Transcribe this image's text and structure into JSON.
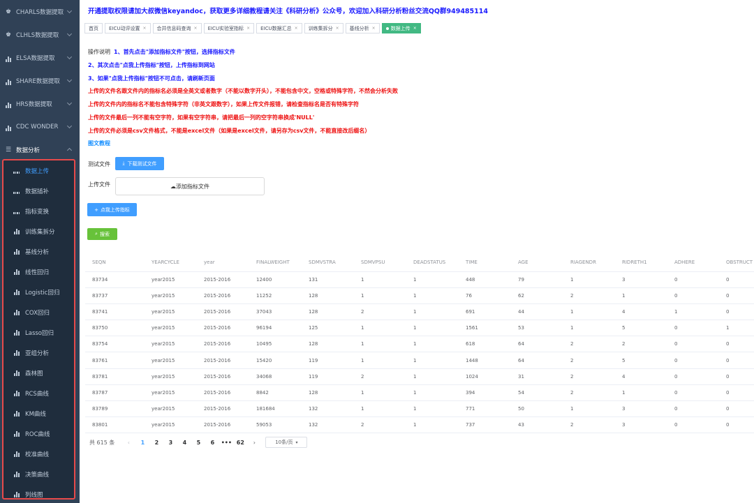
{
  "sidebar": {
    "menus": [
      {
        "label": "CHARLS数据提取",
        "icon": "user-icon"
      },
      {
        "label": "CLHLS数据提取",
        "icon": "user-icon"
      },
      {
        "label": "ELSA数据提取",
        "icon": "bar-chart-icon"
      },
      {
        "label": "SHARE数据提取",
        "icon": "bar-chart-icon"
      },
      {
        "label": "HRS数据提取",
        "icon": "bar-chart-icon"
      },
      {
        "label": "CDC WONDER",
        "icon": "bar-chart-icon"
      },
      {
        "label": "数据分析",
        "icon": "list-icon"
      }
    ],
    "submenu": [
      {
        "label": "数据上传",
        "icon": "grid-icon"
      },
      {
        "label": "数据插补",
        "icon": "grid-icon"
      },
      {
        "label": "指标变换",
        "icon": "grid-icon"
      },
      {
        "label": "训练集拆分",
        "icon": "bar-chart-icon"
      },
      {
        "label": "基线分析",
        "icon": "bar-chart-icon"
      },
      {
        "label": "线性回归",
        "icon": "bar-chart-icon"
      },
      {
        "label": "Logistic回归",
        "icon": "bar-chart-icon"
      },
      {
        "label": "COX回归",
        "icon": "bar-chart-icon"
      },
      {
        "label": "Lasso回归",
        "icon": "bar-chart-icon"
      },
      {
        "label": "亚组分析",
        "icon": "bar-chart-icon"
      },
      {
        "label": "森林图",
        "icon": "bar-chart-icon"
      },
      {
        "label": "RCS曲线",
        "icon": "bar-chart-icon"
      },
      {
        "label": "KM曲线",
        "icon": "bar-chart-icon"
      },
      {
        "label": "ROC曲线",
        "icon": "bar-chart-icon"
      },
      {
        "label": "校准曲线",
        "icon": "bar-chart-icon"
      },
      {
        "label": "决策曲线",
        "icon": "bar-chart-icon"
      },
      {
        "label": "列线图",
        "icon": "bar-chart-icon"
      }
    ]
  },
  "banner": "开通提取权限请加大叔微信keyandoc，获取更多详细教程请关注《科研分析》公众号，欢迎加入科研分析粉丝交流QQ群949485114",
  "tabs": [
    {
      "label": "首页"
    },
    {
      "label": "EICU动评设置"
    },
    {
      "label": "合并信息码查询"
    },
    {
      "label": "EICU实验室指标"
    },
    {
      "label": "EICU数据汇总"
    },
    {
      "label": "训练集拆分"
    },
    {
      "label": "基线分析"
    },
    {
      "label": "数据上传"
    }
  ],
  "instructions": {
    "label": "操作说明",
    "lines": [
      "1、首先点击\"添加指标文件\"按钮，选择指标文件",
      "2、其次点击\"点我上传指标\"按钮，上传指标到网站",
      "3、如果\"点我上传指标\"按钮不可点击，请刷新页面",
      "上传的文件名跟文件内的指标名必须是全英文或者数字（不能以数字开头），不能包含中文，空格或特殊字符，不然会分析失败",
      "上传的文件内的指标名不能包含特殊字符（非英文跟数字），如果上传文件报错，请检查指标名是否有特殊字符",
      "上传的文件最后一列不能有空字符，如果有空字符串，请把最后一列的空字符串换成'NULL'",
      "上传的文件必须是csv文件格式，不能是excel文件（如果是excel文件，请另存为csv文件，不能直接改后缀名）"
    ],
    "tutorial": "图文教程"
  },
  "form": {
    "test_label": "测试文件",
    "download_button": "下载测试文件",
    "upload_label": "上传文件",
    "add_file": "添加指标文件",
    "upload_button": "点我上传指标",
    "search_button": "搜索"
  },
  "table": {
    "headers": [
      "SEQN",
      "YEARCYCLE",
      "year",
      "FINALWEIGHT",
      "SDMVSTRA",
      "SDMVPSU",
      "DEADSTATUS",
      "TIME",
      "AGE",
      "RIAGENDR",
      "RIDRETH1",
      "ADHERE",
      "OBSTRUCT"
    ],
    "rows": [
      [
        "83734",
        "year2015",
        "2015-2016",
        "12400",
        "131",
        "1",
        "1",
        "448",
        "79",
        "1",
        "3",
        "0",
        "0"
      ],
      [
        "83737",
        "year2015",
        "2015-2016",
        "11252",
        "128",
        "1",
        "1",
        "76",
        "62",
        "2",
        "1",
        "0",
        "0"
      ],
      [
        "83741",
        "year2015",
        "2015-2016",
        "37043",
        "128",
        "2",
        "1",
        "691",
        "44",
        "1",
        "4",
        "1",
        "0"
      ],
      [
        "83750",
        "year2015",
        "2015-2016",
        "96194",
        "125",
        "1",
        "1",
        "1561",
        "53",
        "1",
        "5",
        "0",
        "1"
      ],
      [
        "83754",
        "year2015",
        "2015-2016",
        "10495",
        "128",
        "1",
        "1",
        "618",
        "64",
        "2",
        "2",
        "0",
        "0"
      ],
      [
        "83761",
        "year2015",
        "2015-2016",
        "15420",
        "119",
        "1",
        "1",
        "1448",
        "64",
        "2",
        "5",
        "0",
        "0"
      ],
      [
        "83781",
        "year2015",
        "2015-2016",
        "34068",
        "119",
        "2",
        "1",
        "1024",
        "31",
        "2",
        "4",
        "0",
        "0"
      ],
      [
        "83787",
        "year2015",
        "2015-2016",
        "8842",
        "128",
        "1",
        "1",
        "394",
        "54",
        "2",
        "1",
        "0",
        "0"
      ],
      [
        "83789",
        "year2015",
        "2015-2016",
        "181684",
        "132",
        "1",
        "1",
        "771",
        "50",
        "1",
        "3",
        "0",
        "0"
      ],
      [
        "83801",
        "year2015",
        "2015-2016",
        "59053",
        "132",
        "2",
        "1",
        "737",
        "43",
        "2",
        "3",
        "0",
        "0"
      ]
    ]
  },
  "pagination": {
    "total": "共 615 条",
    "pages": [
      "1",
      "2",
      "3",
      "4",
      "5",
      "6",
      "•••",
      "62"
    ],
    "current": "1",
    "page_size": "10条/页"
  }
}
